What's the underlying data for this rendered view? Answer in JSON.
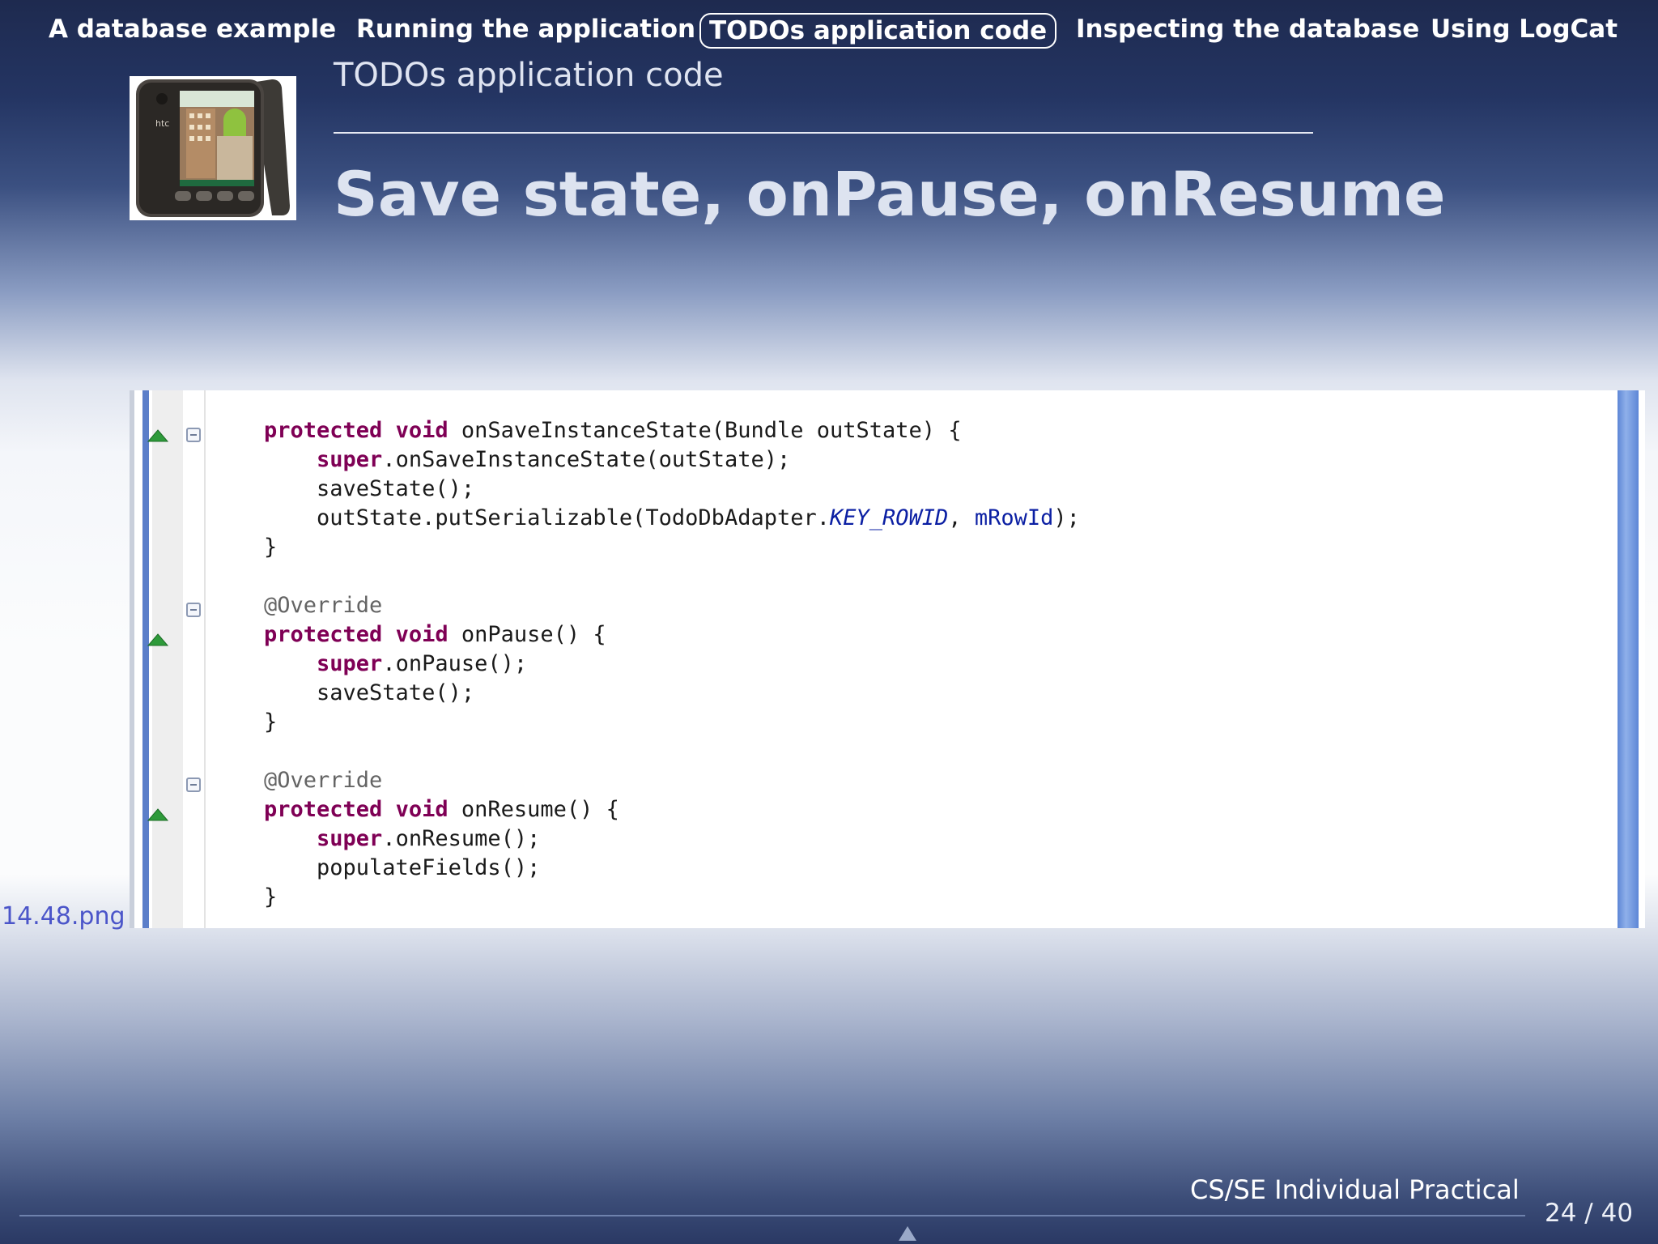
{
  "nav": {
    "items": [
      {
        "label": "A database example"
      },
      {
        "label": "Running the application"
      },
      {
        "label": "TODOs application code",
        "active": true
      },
      {
        "label": "Inspecting the database"
      },
      {
        "label": "Using LogCat"
      }
    ]
  },
  "header": {
    "section_title": "TODOs application code",
    "frame_title": "Save state, onPause, onResume"
  },
  "image": {
    "label": "14.48.png",
    "phone_brand": "htc"
  },
  "code": {
    "lines": [
      "protected void onSaveInstanceState(Bundle outState) {",
      "    super.onSaveInstanceState(outState);",
      "    saveState();",
      "    outState.putSerializable(TodoDbAdapter.KEY_ROWID, mRowId);",
      "}",
      "",
      "@Override",
      "protected void onPause() {",
      "    super.onPause();",
      "    saveState();",
      "}",
      "",
      "@Override",
      "protected void onResume() {",
      "    super.onResume();",
      "    populateFields();",
      "}"
    ]
  },
  "footer": {
    "title": "CS/SE Individual Practical",
    "page": "24 / 40"
  },
  "colors": {
    "keyword": "#7f0055",
    "field": "#0b1fa3",
    "annotation": "#646464",
    "link": "#4b55c9"
  }
}
